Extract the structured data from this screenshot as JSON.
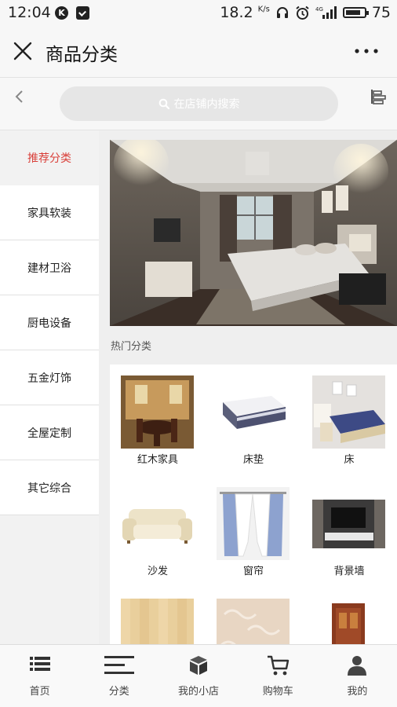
{
  "status_bar": {
    "time": "12:04",
    "k_badge": "K",
    "speed": "18.2",
    "speed_unit": "K/s",
    "network": "4G",
    "battery": "75"
  },
  "header": {
    "title": "商品分类"
  },
  "search": {
    "placeholder": "在店铺内搜索"
  },
  "sidebar": {
    "items": [
      {
        "label": "推荐分类",
        "active": true
      },
      {
        "label": "家具软装",
        "active": false
      },
      {
        "label": "建材卫浴",
        "active": false
      },
      {
        "label": "厨电设备",
        "active": false
      },
      {
        "label": "五金灯饰",
        "active": false
      },
      {
        "label": "全屋定制",
        "active": false
      },
      {
        "label": "其它综合",
        "active": false
      }
    ]
  },
  "main": {
    "hot_title": "热门分类",
    "categories": [
      {
        "label": "红木家具",
        "icon": "mahogany-furniture-image"
      },
      {
        "label": "床垫",
        "icon": "mattress-image"
      },
      {
        "label": "床",
        "icon": "bed-image"
      },
      {
        "label": "沙发",
        "icon": "sofa-image"
      },
      {
        "label": "窗帘",
        "icon": "curtain-image"
      },
      {
        "label": "背景墙",
        "icon": "tv-wall-image"
      },
      {
        "label": "",
        "icon": "wood-floor-image"
      },
      {
        "label": "",
        "icon": "wallpaper-image"
      },
      {
        "label": "",
        "icon": "door-image"
      }
    ]
  },
  "tabbar": {
    "items": [
      {
        "label": "首页",
        "icon": "list-icon"
      },
      {
        "label": "分类",
        "icon": "menu-icon"
      },
      {
        "label": "我的小店",
        "icon": "box-icon"
      },
      {
        "label": "购物车",
        "icon": "cart-icon"
      },
      {
        "label": "我的",
        "icon": "person-icon"
      }
    ]
  },
  "colors": {
    "accent": "#d9403a",
    "background": "#efefef",
    "search_bg": "#e6e6e6"
  }
}
